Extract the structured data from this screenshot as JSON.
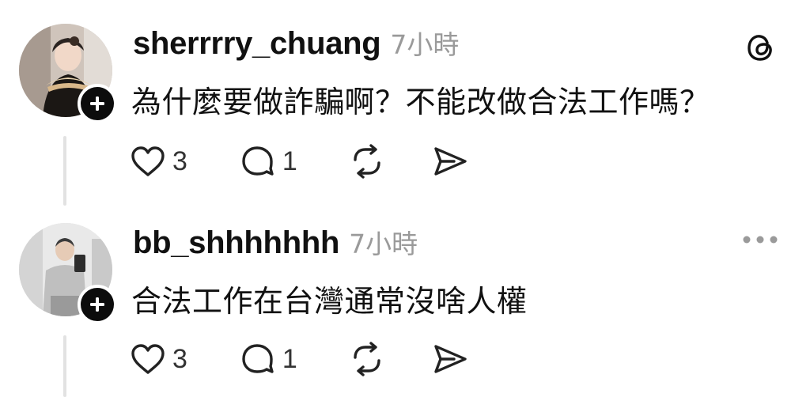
{
  "posts": [
    {
      "username": "sherrrry_chuang",
      "timestamp": "7小時",
      "text": "為什麼要做詐騙啊？不能改做合法工作嗎？",
      "right_icon": "threads-logo-icon",
      "likes": "3",
      "replies": "1",
      "avatar_icon": "avatar-woman-photo"
    },
    {
      "username": "bb_shhhhhhh",
      "timestamp": "7小時",
      "text": "合法工作在台灣通常沒啥人權",
      "right_icon": "more-options-icon",
      "likes": "3",
      "replies": "1",
      "avatar_icon": "avatar-man-mirror-selfie"
    }
  ],
  "action_icons": [
    "heart-icon",
    "comment-icon",
    "repost-icon",
    "share-icon"
  ],
  "colors": {
    "text": "#111111",
    "muted": "#9a9a9a",
    "thread_line": "#e2e2e2",
    "badge": "#0c0c0c"
  }
}
